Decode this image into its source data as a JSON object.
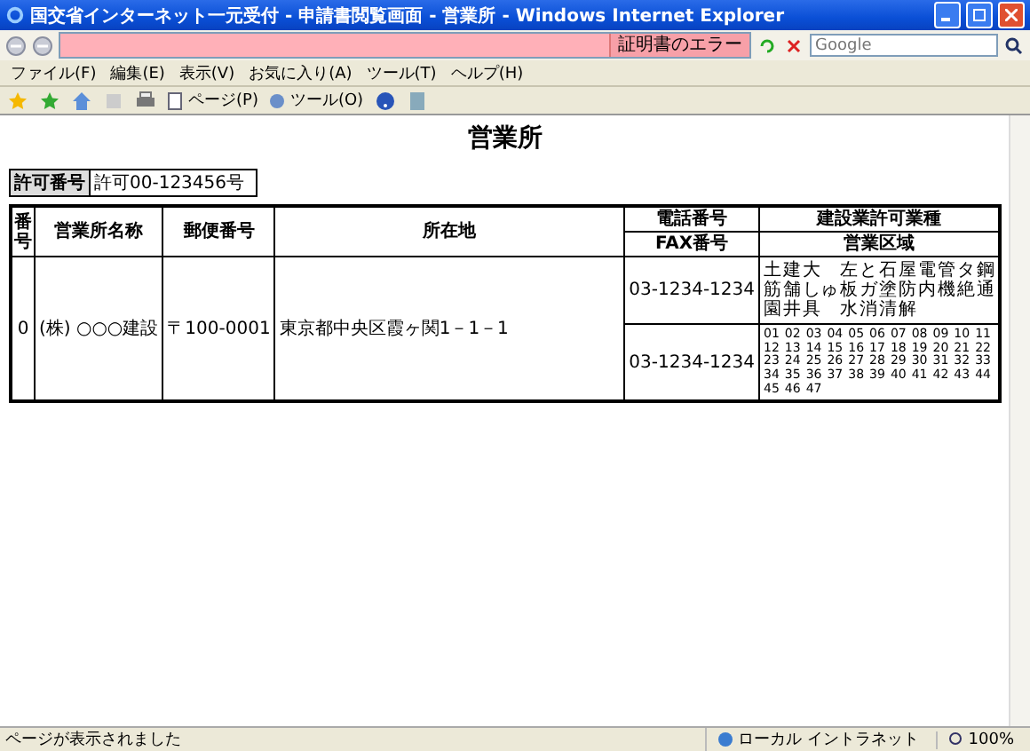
{
  "window": {
    "title": "国交省インターネット一元受付 - 申請書閲覧画面 - 営業所 - Windows Internet Explorer"
  },
  "address_bar": {
    "certificate_error": "証明書のエラー"
  },
  "search": {
    "placeholder": "Google"
  },
  "menu": [
    "ファイル(F)",
    "編集(E)",
    "表示(V)",
    "お気に入り(A)",
    "ツール(T)",
    "ヘルプ(H)"
  ],
  "command_bar": [
    "ページ(P)",
    "ツール(O)"
  ],
  "page": {
    "heading": "営業所",
    "permit_label": "許可番号",
    "permit_number": "許可00-123456号",
    "table": {
      "columns": [
        "番号",
        "営業所名称",
        "郵便番号",
        "所在地"
      ],
      "phone_header": "電話番号",
      "fax_header": "FAX番号",
      "trades_header": "建設業許可業種",
      "area_header": "営業区域",
      "rows": [
        {
          "number": "0",
          "name": "(株) ○○○建設",
          "postal_code": "〒100-0001",
          "address": "東京都中央区霞ヶ関1－1－1",
          "phone": "03-1234-1234",
          "fax": "03-1234-1234",
          "trades": [
            "土",
            "建",
            "大",
            "左",
            "と",
            "石",
            "屋",
            "電",
            "管",
            "タ",
            "鋼",
            "筋",
            "舗",
            "しゅ",
            "板",
            "ガ",
            "塗",
            "防",
            "内",
            "機",
            "絶",
            "通",
            "園",
            "井",
            "具",
            "水",
            "消",
            "清",
            "解"
          ],
          "areas": [
            "01",
            "02",
            "03",
            "04",
            "05",
            "06",
            "07",
            "08",
            "09",
            "10",
            "11",
            "12",
            "13",
            "14",
            "15",
            "16",
            "17",
            "18",
            "19",
            "20",
            "21",
            "22",
            "23",
            "24",
            "25",
            "26",
            "27",
            "28",
            "29",
            "30",
            "31",
            "32",
            "33",
            "34",
            "35",
            "36",
            "37",
            "38",
            "39",
            "40",
            "41",
            "42",
            "43",
            "44",
            "45",
            "46",
            "47"
          ]
        }
      ]
    }
  },
  "status_bar": {
    "message": "ページが表示されました",
    "zone": "ローカル イントラネット",
    "zoom": "100%"
  }
}
